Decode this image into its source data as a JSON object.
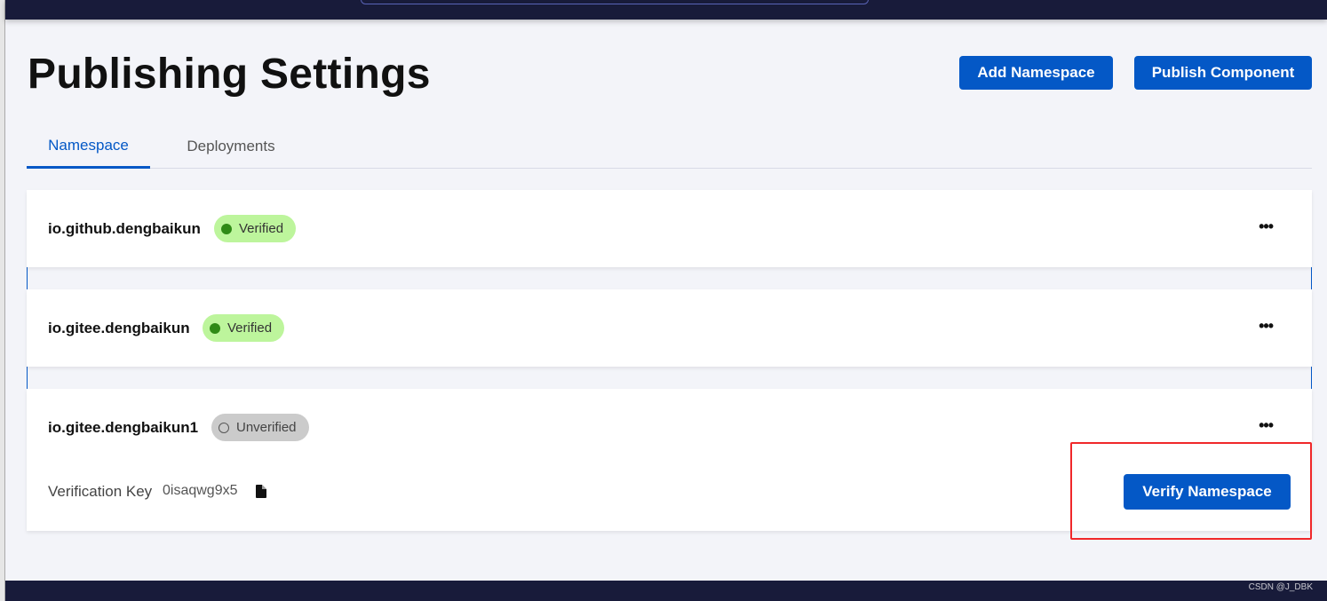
{
  "watermark": "CSDN @J_DBK",
  "page_title": "Publishing Settings",
  "actions": {
    "add_namespace": "Add Namespace",
    "publish_component": "Publish Component"
  },
  "tabs": [
    {
      "label": "Namespace",
      "active": true
    },
    {
      "label": "Deployments",
      "active": false
    }
  ],
  "namespaces": [
    {
      "name": "io.github.dengbaikun",
      "status": "Verified"
    },
    {
      "name": "io.gitee.dengbaikun",
      "status": "Verified"
    },
    {
      "name": "io.gitee.dengbaikun1",
      "status": "Unverified",
      "verification_key_label": "Verification Key",
      "verification_key": "0isaqwg9x5",
      "verify_button": "Verify Namespace"
    }
  ],
  "more_label": "•••",
  "colors": {
    "accent": "#0458c6",
    "verified_bg": "#bdf59c",
    "unverified_bg": "#cbcbcb",
    "nav": "#181b3a",
    "highlight": "#f0282a"
  }
}
